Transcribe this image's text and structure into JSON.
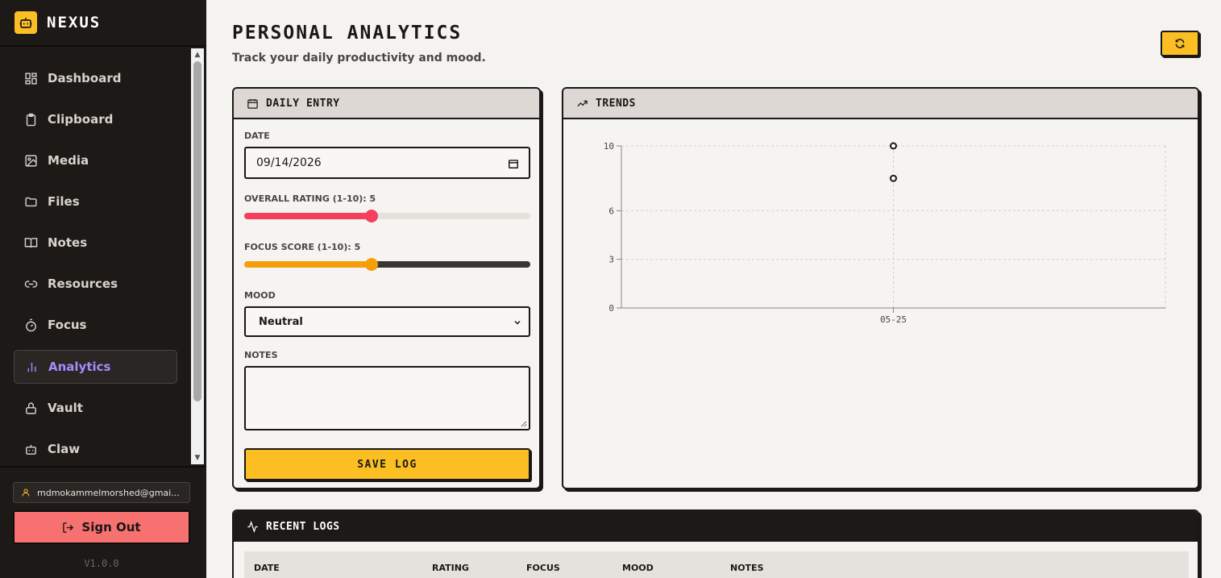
{
  "app": {
    "name": "NEXUS",
    "version": "V1.0.0"
  },
  "sidebar": {
    "items": [
      {
        "label": "Dashboard",
        "icon": "grid-icon"
      },
      {
        "label": "Clipboard",
        "icon": "clipboard-icon"
      },
      {
        "label": "Media",
        "icon": "image-icon"
      },
      {
        "label": "Files",
        "icon": "folder-icon"
      },
      {
        "label": "Notes",
        "icon": "book-icon"
      },
      {
        "label": "Resources",
        "icon": "link-icon"
      },
      {
        "label": "Focus",
        "icon": "timer-icon"
      },
      {
        "label": "Analytics",
        "icon": "bar-chart-icon",
        "active": true
      },
      {
        "label": "Vault",
        "icon": "lock-icon"
      },
      {
        "label": "Claw",
        "icon": "bot-icon"
      }
    ],
    "user_email": "mdmokammelmorshed@gmai...",
    "signout_label": "Sign Out"
  },
  "header": {
    "title": "PERSONAL ANALYTICS",
    "subtitle": "Track your daily productivity and mood."
  },
  "daily_entry": {
    "title": "DAILY ENTRY",
    "date_label": "DATE",
    "date_value": "09/14/2026",
    "rating_label": "OVERALL RATING (1-10): 5",
    "rating_value": 5,
    "focus_label": "FOCUS SCORE (1-10): 5",
    "focus_value": 5,
    "mood_label": "MOOD",
    "mood_value": "Neutral",
    "notes_label": "NOTES",
    "notes_value": "",
    "save_label": "SAVE LOG"
  },
  "trends": {
    "title": "TRENDS",
    "chart_data": {
      "type": "scatter",
      "title": "",
      "xlabel": "",
      "ylabel": "",
      "x": [
        "05-25"
      ],
      "series": [
        {
          "values": [
            10
          ]
        },
        {
          "values": [
            8
          ]
        }
      ],
      "y_ticks": [
        0,
        3,
        6,
        10
      ],
      "ylim": [
        0,
        10
      ],
      "grid": true
    }
  },
  "recent_logs": {
    "title": "RECENT LOGS",
    "columns": [
      "DATE",
      "RATING",
      "FOCUS",
      "MOOD",
      "NOTES"
    ]
  },
  "colors": {
    "accent": "#fbbf24",
    "rating_slider": "#f43f5e",
    "focus_slider": "#f59e0b",
    "active_nav": "#a78bfa",
    "signout": "#f87171"
  }
}
